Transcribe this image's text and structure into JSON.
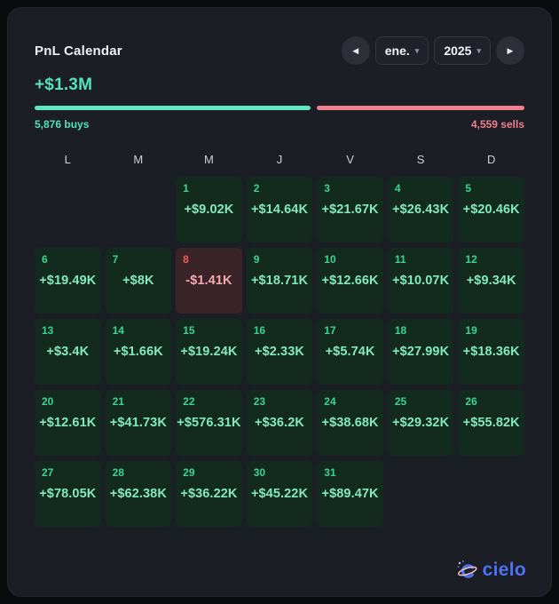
{
  "header": {
    "title": "PnL Calendar",
    "month_selector": {
      "value": "ene."
    },
    "year_selector": {
      "value": "2025"
    }
  },
  "icons": {
    "prev": "◀",
    "next": "▶",
    "caret_down": "▾"
  },
  "summary": {
    "total_pnl": "+$1.3M",
    "buys_label": "5,876 buys",
    "sells_label": "4,559 sells",
    "buys_pct": 56.3,
    "sells_pct": 43.7
  },
  "calendar": {
    "weekdays": [
      "L",
      "M",
      "M",
      "J",
      "V",
      "S",
      "D"
    ],
    "leading_empty": 2,
    "trailing_empty": 2,
    "days": [
      {
        "day": 1,
        "value": "+$9.02K",
        "type": "gain"
      },
      {
        "day": 2,
        "value": "+$14.64K",
        "type": "gain"
      },
      {
        "day": 3,
        "value": "+$21.67K",
        "type": "gain"
      },
      {
        "day": 4,
        "value": "+$26.43K",
        "type": "gain"
      },
      {
        "day": 5,
        "value": "+$20.46K",
        "type": "gain"
      },
      {
        "day": 6,
        "value": "+$19.49K",
        "type": "gain"
      },
      {
        "day": 7,
        "value": "+$8K",
        "type": "gain"
      },
      {
        "day": 8,
        "value": "-$1.41K",
        "type": "loss"
      },
      {
        "day": 9,
        "value": "+$18.71K",
        "type": "gain"
      },
      {
        "day": 10,
        "value": "+$12.66K",
        "type": "gain"
      },
      {
        "day": 11,
        "value": "+$10.07K",
        "type": "gain"
      },
      {
        "day": 12,
        "value": "+$9.34K",
        "type": "gain"
      },
      {
        "day": 13,
        "value": "+$3.4K",
        "type": "gain"
      },
      {
        "day": 14,
        "value": "+$1.66K",
        "type": "gain"
      },
      {
        "day": 15,
        "value": "+$19.24K",
        "type": "gain"
      },
      {
        "day": 16,
        "value": "+$2.33K",
        "type": "gain"
      },
      {
        "day": 17,
        "value": "+$5.74K",
        "type": "gain"
      },
      {
        "day": 18,
        "value": "+$27.99K",
        "type": "gain"
      },
      {
        "day": 19,
        "value": "+$18.36K",
        "type": "gain"
      },
      {
        "day": 20,
        "value": "+$12.61K",
        "type": "gain"
      },
      {
        "day": 21,
        "value": "+$41.73K",
        "type": "gain"
      },
      {
        "day": 22,
        "value": "+$576.31K",
        "type": "gain"
      },
      {
        "day": 23,
        "value": "+$36.2K",
        "type": "gain"
      },
      {
        "day": 24,
        "value": "+$38.68K",
        "type": "gain"
      },
      {
        "day": 25,
        "value": "+$29.32K",
        "type": "gain"
      },
      {
        "day": 26,
        "value": "+$55.82K",
        "type": "gain"
      },
      {
        "day": 27,
        "value": "+$78.05K",
        "type": "gain"
      },
      {
        "day": 28,
        "value": "+$62.38K",
        "type": "gain"
      },
      {
        "day": 29,
        "value": "+$36.22K",
        "type": "gain"
      },
      {
        "day": 30,
        "value": "+$45.22K",
        "type": "gain"
      },
      {
        "day": 31,
        "value": "+$89.47K",
        "type": "gain"
      }
    ]
  },
  "footer": {
    "brand": "cielo"
  },
  "colors": {
    "page_bg": "#0a0b0e",
    "card_bg": "#1b1e25",
    "teal_accent": "#5fe8c4",
    "pink_accent": "#f27e8d",
    "gain_cell_bg": "#132a1f",
    "loss_cell_bg": "#3b2427",
    "gain_value_text": "#83e9bd",
    "loss_value_text": "#f6a9b1",
    "gain_day_number": "#3bd493",
    "loss_day_number": "#ef5b5b",
    "brand_blue": "#4d72f2"
  }
}
